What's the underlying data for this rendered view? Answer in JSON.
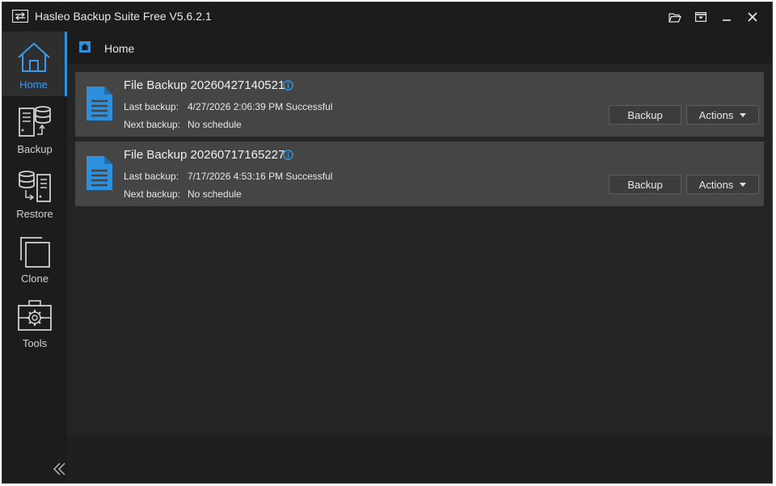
{
  "window": {
    "title": "Hasleo Backup Suite Free V5.6.2.1"
  },
  "sidebar": {
    "items": [
      {
        "label": "Home",
        "icon": "home-icon",
        "active": true
      },
      {
        "label": "Backup",
        "icon": "backup-icon",
        "active": false
      },
      {
        "label": "Restore",
        "icon": "restore-icon",
        "active": false
      },
      {
        "label": "Clone",
        "icon": "clone-icon",
        "active": false
      },
      {
        "label": "Tools",
        "icon": "tools-icon",
        "active": false
      }
    ]
  },
  "breadcrumb": {
    "current": "Home"
  },
  "tasks": [
    {
      "title": "File Backup 20260427140521",
      "last_backup_label": "Last backup:",
      "last_backup_value": "4/27/2026 2:06:39 PM Successful",
      "next_backup_label": "Next backup:",
      "next_backup_value": "No schedule",
      "backup_button": "Backup",
      "actions_button": "Actions"
    },
    {
      "title": "File Backup 20260717165227",
      "last_backup_label": "Last backup:",
      "last_backup_value": "7/17/2026 4:53:16 PM Successful",
      "next_backup_label": "Next backup:",
      "next_backup_value": "No schedule",
      "backup_button": "Backup",
      "actions_button": "Actions"
    }
  ],
  "colors": {
    "accent": "#2e8fdc",
    "background": "#1f1f1f",
    "card": "#454545"
  }
}
